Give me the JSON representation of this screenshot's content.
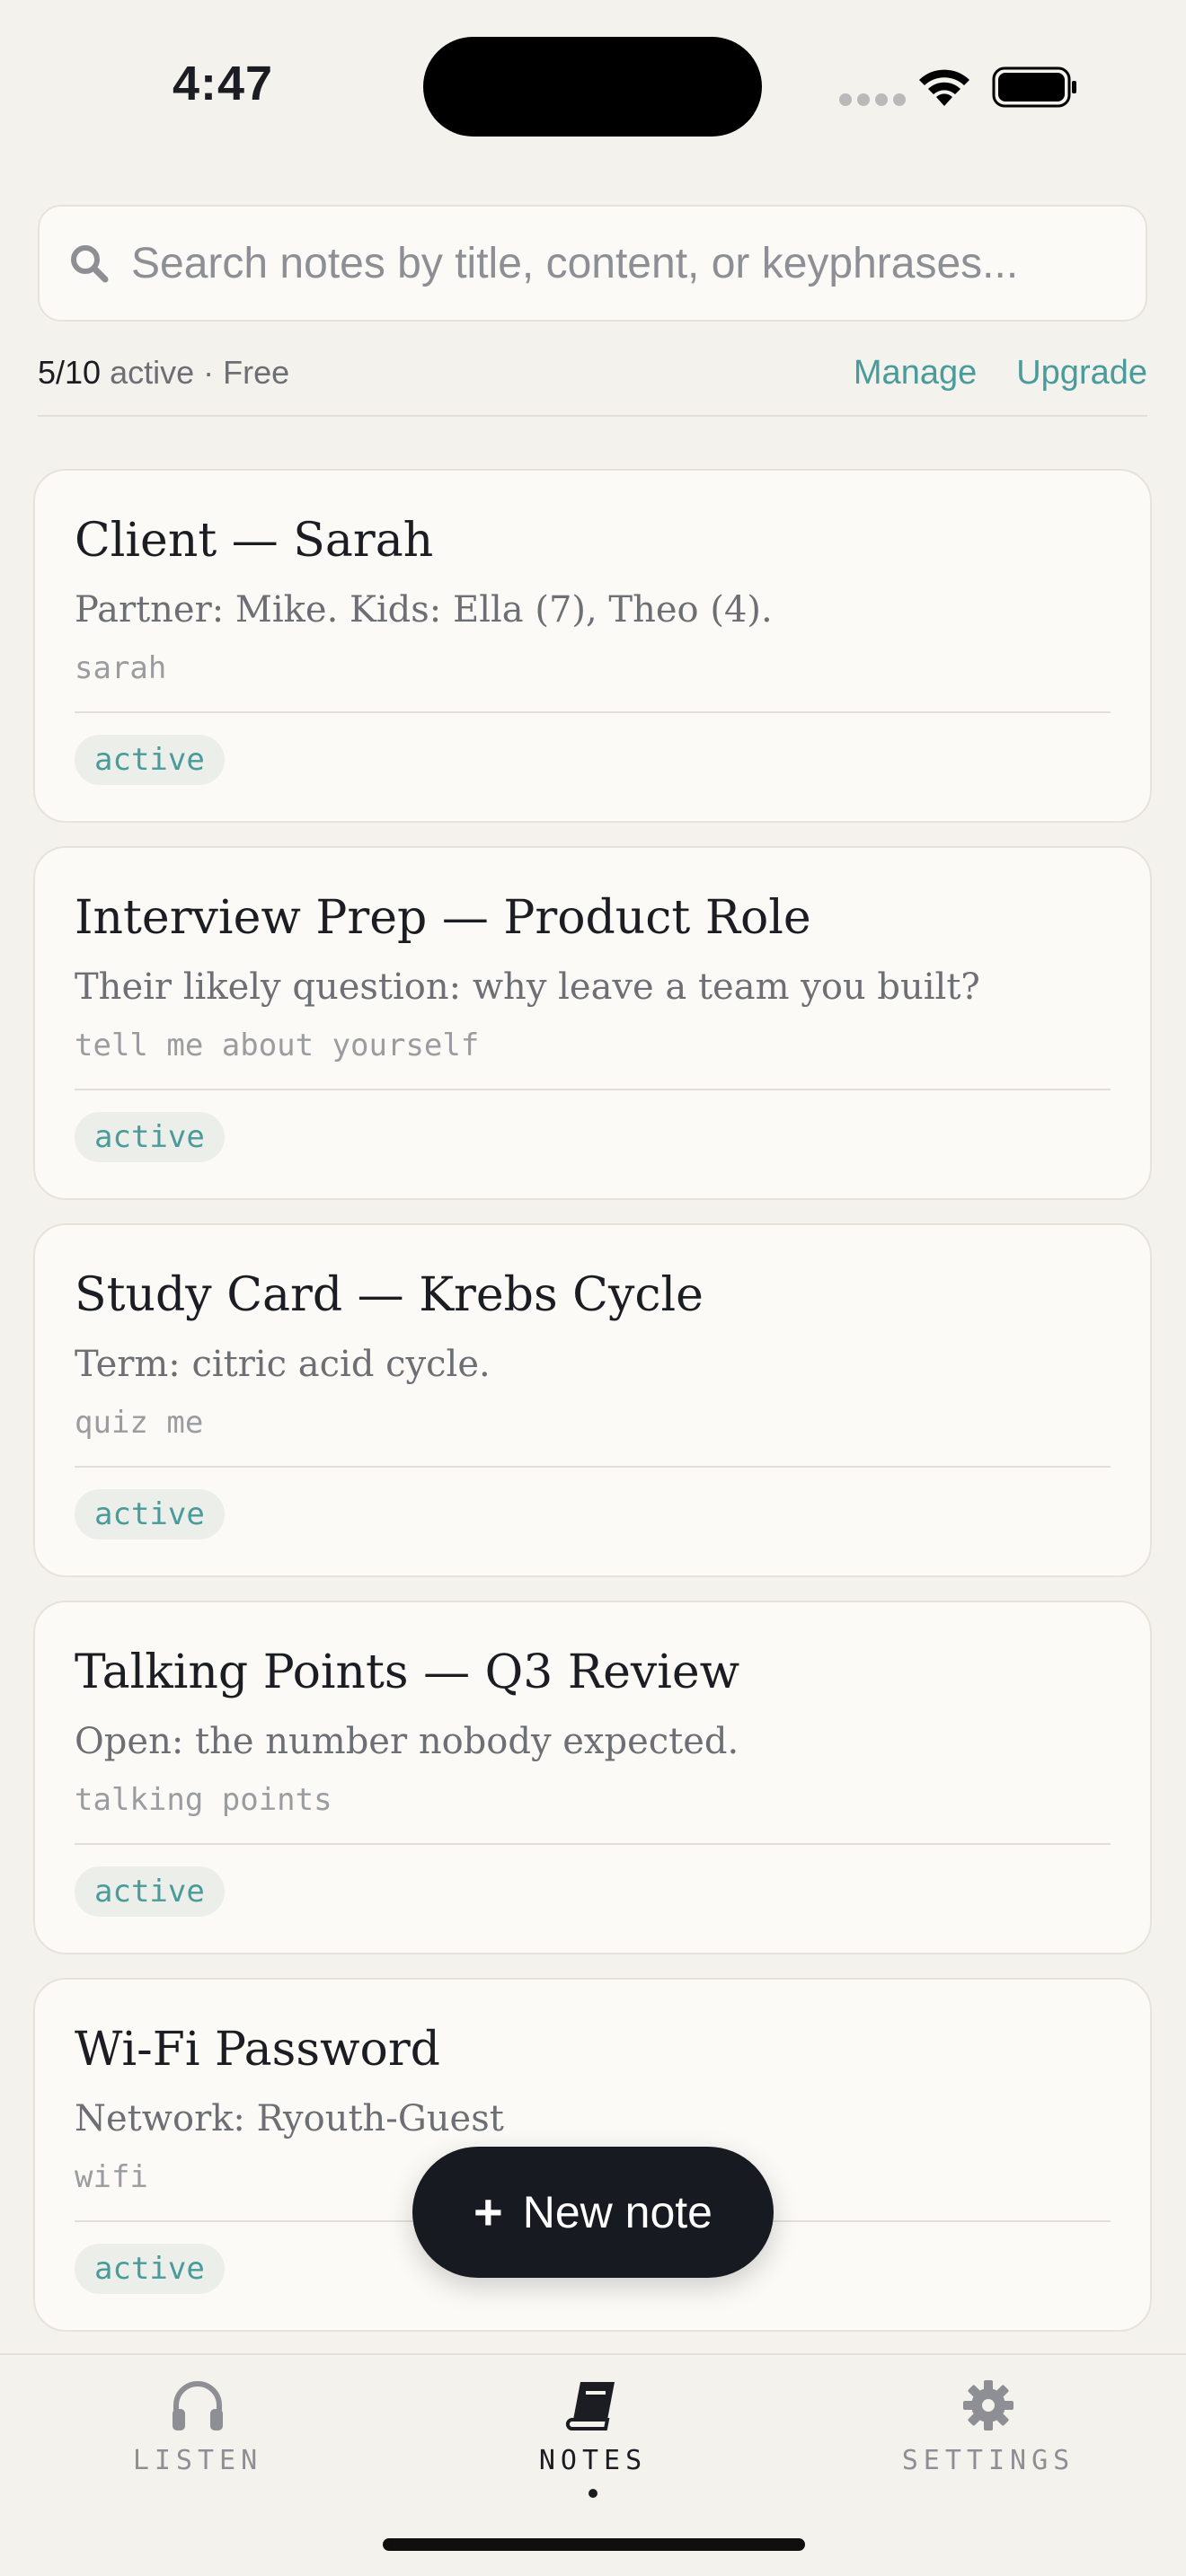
{
  "status": {
    "time": "4:47"
  },
  "search": {
    "placeholder": "Search notes by title, content, or keyphrases..."
  },
  "meta": {
    "count": "5/10",
    "rest": "active · Free",
    "manage": "Manage",
    "upgrade": "Upgrade"
  },
  "notes": [
    {
      "title": "Client — Sarah",
      "body": "Partner: Mike. Kids: Ella (7), Theo (4).",
      "key": "sarah",
      "status": "active"
    },
    {
      "title": "Interview Prep — Product Role",
      "body": "Their likely question: why leave a team you built?",
      "key": "tell me about yourself",
      "status": "active"
    },
    {
      "title": "Study Card — Krebs Cycle",
      "body": "Term: citric acid cycle.",
      "key": "quiz me",
      "status": "active"
    },
    {
      "title": "Talking Points — Q3 Review",
      "body": "Open: the number nobody expected.",
      "key": "talking points",
      "status": "active"
    },
    {
      "title": "Wi-Fi Password",
      "body": "Network: Ryouth-Guest",
      "key": "wifi",
      "status": "active"
    }
  ],
  "fab": {
    "label": "New note"
  },
  "tabs": [
    {
      "label": "LISTEN",
      "icon": "headphones-icon"
    },
    {
      "label": "NOTES",
      "icon": "book-icon",
      "active": true
    },
    {
      "label": "SETTINGS",
      "icon": "gear-icon"
    }
  ],
  "colors": {
    "accent": "#4a9b9b",
    "background": "#f4f2ed",
    "card": "#fbfaf6",
    "fab": "#171a20"
  }
}
